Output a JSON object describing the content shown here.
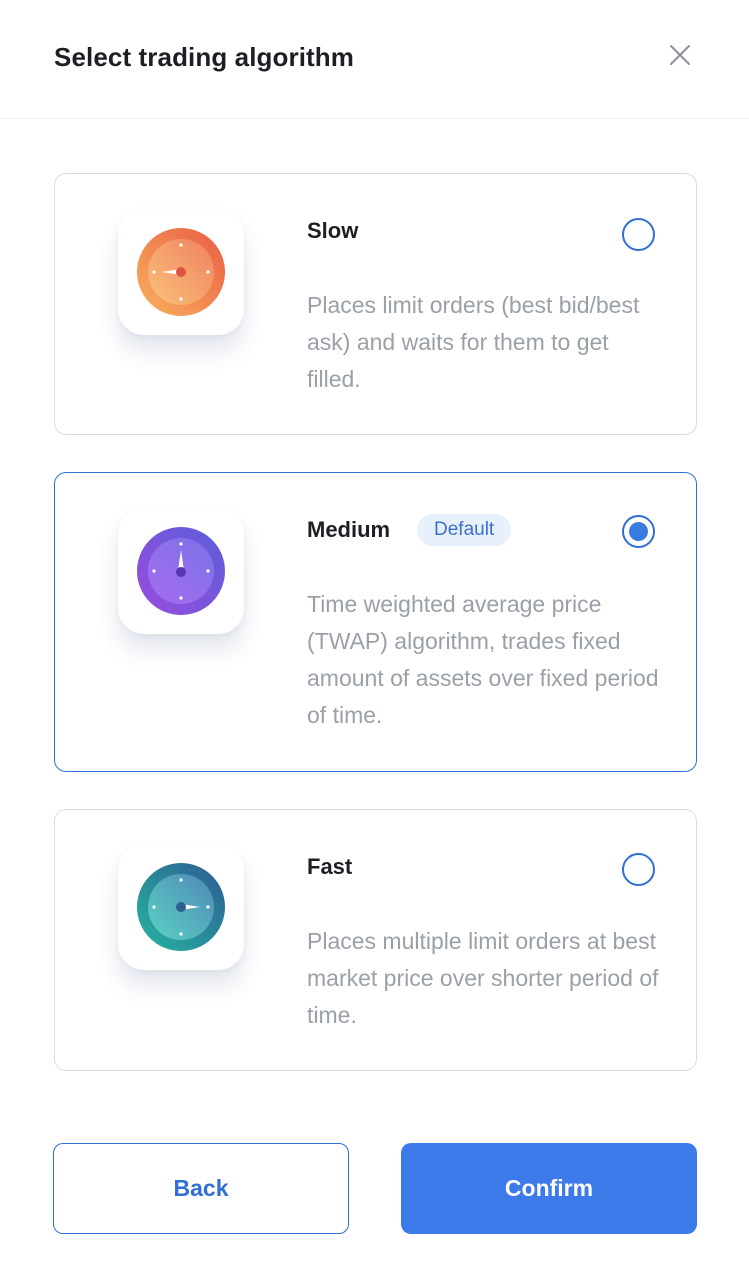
{
  "header": {
    "title": "Select trading algorithm",
    "close_icon": "close-icon"
  },
  "options": [
    {
      "name": "Slow",
      "badge": "",
      "selected": false,
      "description": "Places limit orders (best bid/best ask) and waits for them to get filled.",
      "icon": "gauge-icon",
      "colors": [
        "#f5a35a",
        "#ea6a47"
      ]
    },
    {
      "name": "Medium",
      "badge": "Default",
      "selected": true,
      "description": "Time weighted average price (TWAP) algorithm, trades fixed amount of assets over fixed period of time.",
      "icon": "gauge-icon",
      "colors": [
        "#8d5bf0",
        "#6d3cc6"
      ]
    },
    {
      "name": "Fast",
      "badge": "",
      "selected": false,
      "description": "Places multiple limit orders at best market price over shorter period of time.",
      "icon": "gauge-icon",
      "colors": [
        "#3bb9a9",
        "#2a6a9a"
      ]
    }
  ],
  "footer": {
    "back_label": "Back",
    "confirm_label": "Confirm"
  },
  "colors": {
    "accent": "#3b7ae8",
    "selected_border": "#2f6fd6",
    "badge_bg": "#e8f0fb",
    "text_primary": "#1c1f24",
    "text_secondary": "#9aa0a8"
  }
}
